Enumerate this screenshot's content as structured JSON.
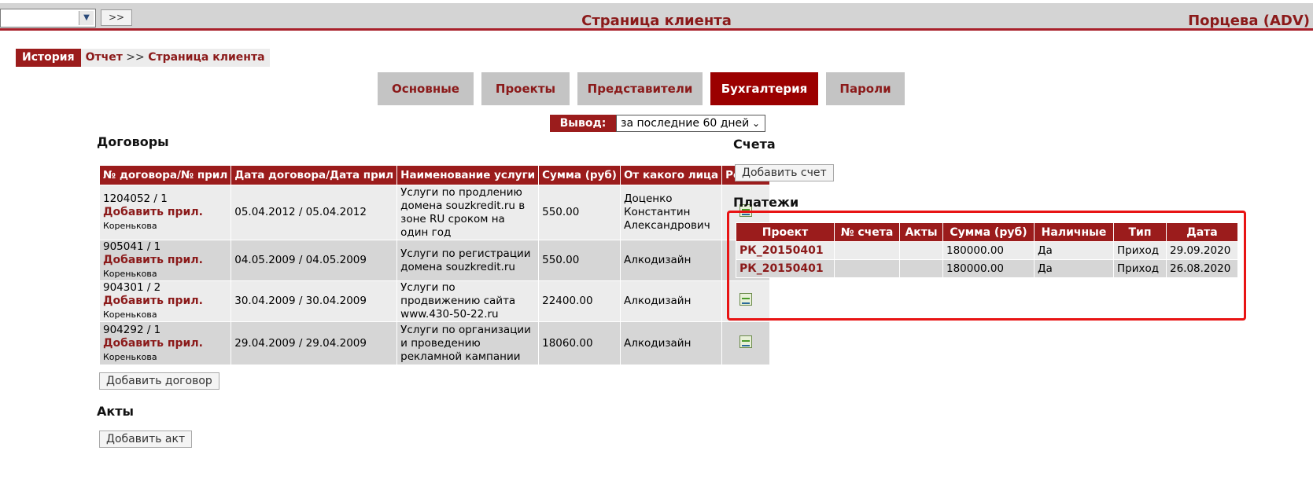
{
  "header": {
    "nav_button": ">>",
    "title": "Страница клиента",
    "user": "Порцева (ADV)"
  },
  "breadcrumb": {
    "history": "История",
    "report": "Отчет",
    "separator": ">>",
    "current": "Страница клиента"
  },
  "tabs": [
    {
      "label": "Основные",
      "active": false
    },
    {
      "label": "Проекты",
      "active": false
    },
    {
      "label": "Представители",
      "active": false
    },
    {
      "label": "Бухгалтерия",
      "active": true
    },
    {
      "label": "Пароли",
      "active": false
    }
  ],
  "output": {
    "label": "Вывод:",
    "selected": "за последние 60 дней"
  },
  "contracts": {
    "title": "Договоры",
    "columns": [
      "№ договора/№ прил",
      "Дата договора/Дата прил",
      "Наименование услуги",
      "Сумма (руб)",
      "От какого лица",
      "Ред-ть"
    ],
    "add_attachment_label": "Добавить прил.",
    "rows": [
      {
        "number": "1204052 / 1",
        "author": "Коренькова",
        "date": "05.04.2012 / 05.04.2012",
        "service": "Услуги по продлению домена souzkredit.ru в зоне RU сроком на один год",
        "sum": "550.00",
        "entity": "Доценко Константин Александрович"
      },
      {
        "number": "905041 / 1",
        "author": "Коренькова",
        "date": "04.05.2009 / 04.05.2009",
        "service": "Услуги по регистрации домена souzkredit.ru",
        "sum": "550.00",
        "entity": "Алкодизайн"
      },
      {
        "number": "904301 / 2",
        "author": "Коренькова",
        "date": "30.04.2009 / 30.04.2009",
        "service": "Услуги по продвижению сайта www.430-50-22.ru",
        "sum": "22400.00",
        "entity": "Алкодизайн"
      },
      {
        "number": "904292 / 1",
        "author": "Коренькова",
        "date": "29.04.2009 / 29.04.2009",
        "service": "Услуги по организации и проведению рекламной кампании",
        "sum": "18060.00",
        "entity": "Алкодизайн"
      }
    ],
    "add_button": "Добавить договор"
  },
  "acts": {
    "title": "Акты",
    "add_button": "Добавить акт"
  },
  "invoices": {
    "title": "Счета",
    "add_button": "Добавить счет"
  },
  "payments": {
    "title": "Платежи",
    "columns": [
      "Проект",
      "№ счета",
      "Акты",
      "Сумма (руб)",
      "Наличные",
      "Тип",
      "Дата"
    ],
    "rows": [
      {
        "project": "РК_20150401",
        "invoice": "",
        "acts": "",
        "sum": "180000.00",
        "cash": "Да",
        "type": "Приход",
        "date": "29.09.2020"
      },
      {
        "project": "РК_20150401",
        "invoice": "",
        "acts": "",
        "sum": "180000.00",
        "cash": "Да",
        "type": "Приход",
        "date": "26.08.2020"
      }
    ]
  },
  "colors": {
    "brand": "#9b1c1c",
    "highlight": "#e81414"
  },
  "icons": {
    "edit": "edit-document-icon",
    "dropdown": "chevron-down-icon"
  }
}
